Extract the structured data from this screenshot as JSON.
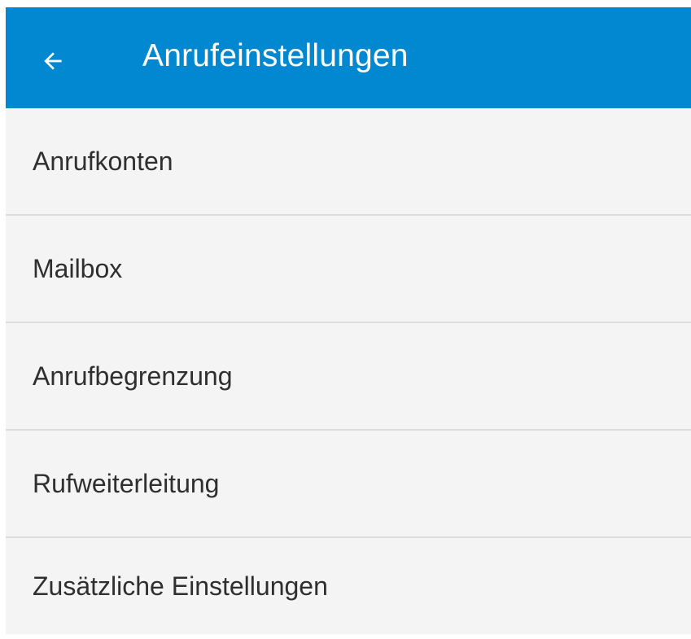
{
  "app_bar": {
    "title": "Anrufeinstellungen",
    "back_icon": "arrow-left-icon",
    "background_color": "#0288d1",
    "title_color": "#ffffff"
  },
  "settings": {
    "items": [
      {
        "label": "Anrufkonten"
      },
      {
        "label": "Mailbox"
      },
      {
        "label": "Anrufbegrenzung"
      },
      {
        "label": "Rufweiterleitung"
      },
      {
        "label": "Zusätzliche Einstellungen"
      }
    ]
  }
}
